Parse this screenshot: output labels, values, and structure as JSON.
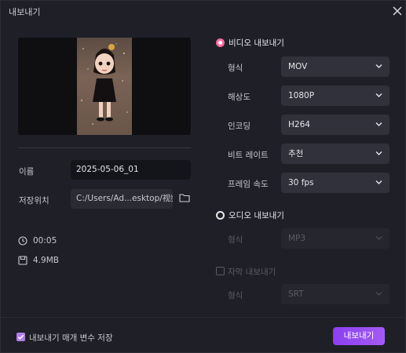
{
  "window": {
    "title": "내보내기"
  },
  "left": {
    "name_label": "이름",
    "name_value": "2025-05-06_01",
    "location_label": "저장위치",
    "location_value": "C:/Users/Ad...esktop/视频素材",
    "duration": "00:05",
    "size": "4.9MB"
  },
  "video": {
    "section_label": "비디오 내보내기",
    "selected": true,
    "rows": [
      {
        "label": "형식",
        "value": "MOV"
      },
      {
        "label": "해상도",
        "value": "1080P"
      },
      {
        "label": "인코딩",
        "value": "H264"
      },
      {
        "label": "비트 레이트",
        "value": "추천"
      },
      {
        "label": "프레임 속도",
        "value": "30  fps"
      }
    ]
  },
  "audio": {
    "section_label": "오디오 내보내기",
    "selected": false,
    "format_label": "형식",
    "format_value": "MP3"
  },
  "subtitle": {
    "checkbox_label": "자막 내보내기",
    "checked": false,
    "format_label": "형식",
    "format_value": "SRT"
  },
  "footer": {
    "save_params_label": "내보내기 매개 변수 저장",
    "save_params_checked": true,
    "export_button": "내보내기"
  },
  "colors": {
    "accent": "#a45bf4",
    "radio_on": "#ff6c9d",
    "checkbox_on": "#b07fe4"
  }
}
